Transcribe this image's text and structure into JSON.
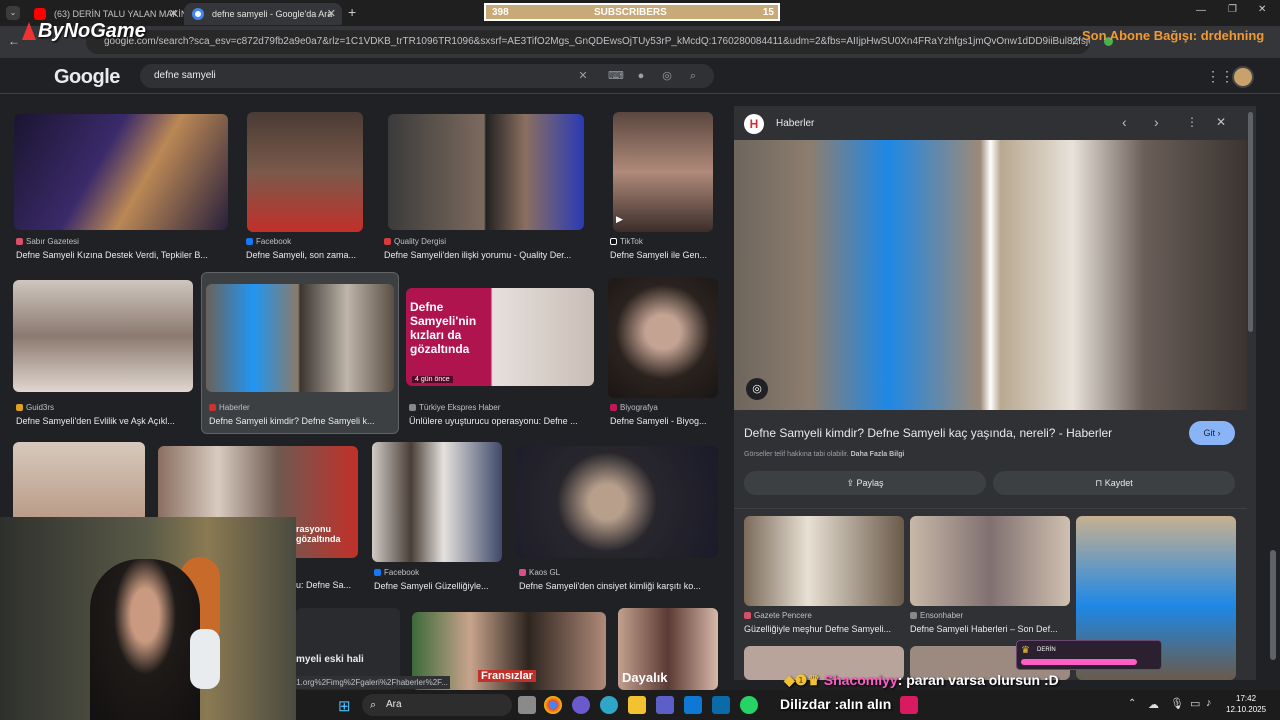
{
  "browser": {
    "tabs": [
      {
        "label": "(63) DERİN TALU YALAN MAKİN",
        "icon": "youtube-icon"
      },
      {
        "label": "defne samyeli - Google'da Ara",
        "icon": "google-icon"
      }
    ],
    "new_tab": "+",
    "url": "google.com/search?sca_esv=c872d79fb2a9e0a7&rlz=1C1VDKB_trTR1096TR1096&sxsrf=AE3TifO2Mgs_GnQDEwsOjTUy53rP_kMcdQ:1760280084411&udm=2&fbs=AIIjpHwSU0Xn4FRaYzhfgs1jmQvOnw1dDD9iiBul82fsjeHv6Suaj0uW..."
  },
  "stream": {
    "logo": "ByNoGame",
    "sub_left": "398",
    "sub_label": "SUBSCRIBERS",
    "sub_right": "15",
    "donation": "Son Abone Bağışı: drdehning",
    "chat_user": "Shacomiyy",
    "chat_msg": ": paran varsa olursun :D",
    "chat2": "Dilizdar :alın alın",
    "donation_box": "DERİN"
  },
  "google": {
    "logo": "Google",
    "query": "defne samyeli",
    "results": [
      {
        "source": "Sabır Gazetesi",
        "title": "Defne Samyeli Kızına Destek Verdi, Tepkiler B..."
      },
      {
        "source": "Facebook",
        "title": "Defne Samyeli, son zama..."
      },
      {
        "source": "Quality Dergisi",
        "title": "Defne Samyeli'den ilişki yorumu - Quality Der..."
      },
      {
        "source": "TikTok",
        "title": "Defne Samyeli ile Gen..."
      },
      {
        "source": "Guid3rs",
        "title": "Defne Samyeli'den Evlilik ve Aşk Açıkl..."
      },
      {
        "source": "Haberler",
        "title": "Defne Samyeli kimdir? Defne Samyeli k..."
      },
      {
        "source": "Türkiye Ekspres Haber",
        "title": "Ünlülere uyuşturucu operasyonu: Defne ..."
      },
      {
        "source": "Biyografya",
        "title": "Defne Samyeli - Biyog..."
      },
      {
        "source": "Facebook",
        "title": "Defne Samyeli Güzelliğiyle..."
      },
      {
        "source": "Kaos GL",
        "title": "Defne Samyeli'den cinsiyet kimliği karşıtı ko..."
      }
    ],
    "partial_caption": "u: Defne Sa...",
    "eski_hali": "myeli eski hali",
    "status_url": "gl1.org%2Fimg%2Fgaleri%2Fhaberler%2F...",
    "thumb_text1": "Defne Samyeli'nin kızları da gözaltında",
    "thumb_badge": "4 gün önce",
    "thumb_text2": "rasyonu gözaltında",
    "thumb_text3": "Fransızlar",
    "thumb_text4": "Dayalık"
  },
  "panel": {
    "source": "Haberler",
    "title": "Defne Samyeli kimdir? Defne Samyeli kaç yaşında, nereli? - Haberler",
    "go": "Git",
    "notice": "Görseller telif hakkına tabi olabilir.",
    "more": "Daha Fazla Bilgi",
    "share": "Paylaş",
    "save": "Kaydet",
    "related": [
      {
        "source": "Gazete Pencere",
        "title": "Güzelliğiyle meşhur Defne Samyeli..."
      },
      {
        "source": "Ensonhaber",
        "title": "Defne Samyeli Haberleri – Son Def..."
      }
    ]
  },
  "taskbar": {
    "search": "Ara",
    "time": "17:42",
    "date": "12.10.2025"
  },
  "colors": {
    "bg": "#202124",
    "panel": "#303134",
    "go": "#8ab4f8",
    "accent_orange": "#f29a2e",
    "chat_pink": "#ff5ec4"
  }
}
